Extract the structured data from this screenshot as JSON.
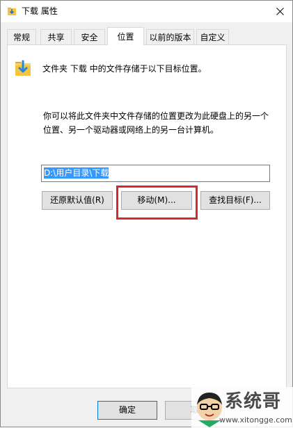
{
  "window": {
    "title": "下载 属性",
    "icon": "folder-download-icon"
  },
  "tabs": [
    {
      "label": "常规"
    },
    {
      "label": "共享"
    },
    {
      "label": "安全"
    },
    {
      "label": "位置",
      "active": true
    },
    {
      "label": "以前的版本"
    },
    {
      "label": "自定义"
    }
  ],
  "location": {
    "header": "文件夹 下载 中的文件存储于以下目标位置。",
    "description_line1": "你可以将此文件夹中文件存储的位置更改为此硬盘上的另一个",
    "description_line2": "位置、另一个驱动器或网络上的另一台计算机。",
    "path_value": "D:\\用户目录\\下载"
  },
  "buttons": {
    "restore_default": "还原默认值(R)",
    "move": "移动(M)...",
    "find_target": "查找目标(F)...",
    "ok": "确定",
    "cancel": "取"
  },
  "watermark": {
    "brand": "系统哥",
    "url": "www.xitongge.com"
  },
  "colors": {
    "highlight_border": "#d7282a",
    "selection": "#3399ff",
    "folder_yellow": "#f5c542",
    "arrow_blue": "#1e88e5"
  }
}
